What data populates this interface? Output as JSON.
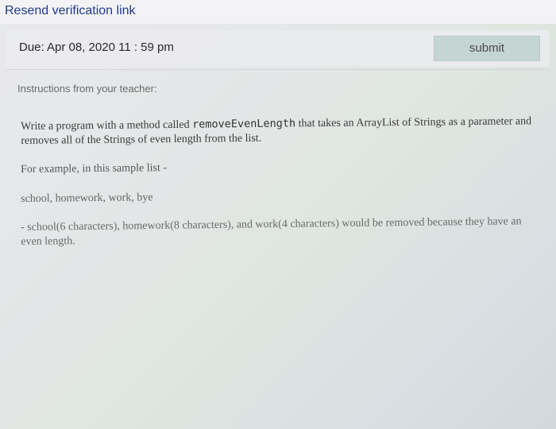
{
  "header": {
    "resend_link": "Resend verification link"
  },
  "assignment": {
    "due": "Due: Apr 08, 2020 11 : 59 pm",
    "submit_label": "submit"
  },
  "instructions": {
    "heading": "Instructions from your teacher:",
    "para1_pre": "Write a program with a  method called ",
    "para1_code": "removeEvenLength",
    "para1_post": " that takes an ArrayList of Strings as a parameter and removes all of the Strings of even length from the list.",
    "example_intro": "For example, in this sample list -",
    "sample_list": "school, homework, work, bye",
    "removal_note": "- school(6 characters), homework(8 characters), and work(4 characters) would be removed because they have an even length."
  }
}
